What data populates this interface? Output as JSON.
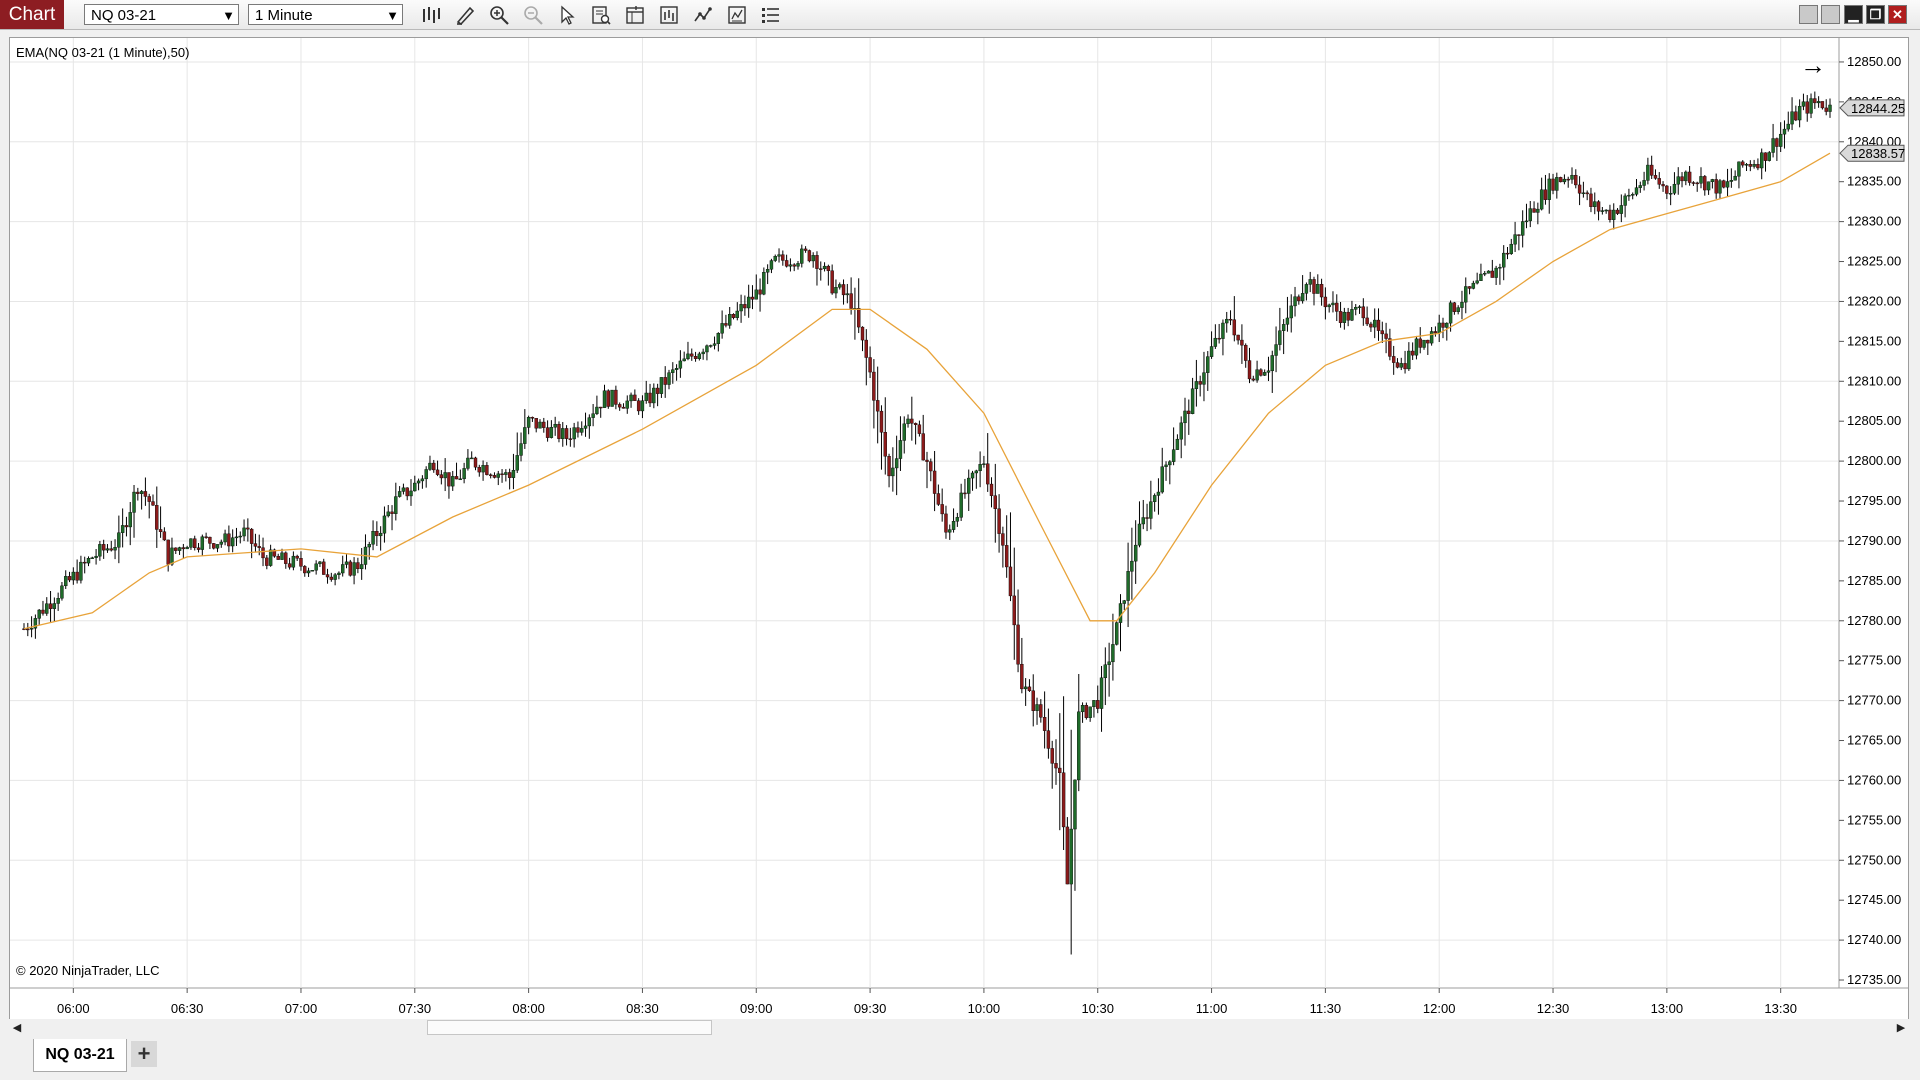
{
  "toolbar": {
    "chart_label": "Chart",
    "instrument": "NQ 03-21",
    "interval": "1 Minute",
    "icons": [
      "bar-type-icon",
      "drawing-tools-icon",
      "zoom-in-icon",
      "zoom-out-icon",
      "pointer-icon",
      "data-box-icon",
      "properties-icon",
      "indicators-icon",
      "strategies-icon",
      "templates-icon"
    ],
    "window_buttons": [
      "minimize-icon",
      "restore-icon",
      "maximize-icon",
      "close-icon"
    ]
  },
  "indicator_label": "EMA(NQ 03-21 (1 Minute),50)",
  "copyright": "© 2020 NinjaTrader, LLC",
  "tabs": [
    {
      "label": "NQ 03-21"
    }
  ],
  "add_tab_label": "+",
  "chart_data": {
    "type": "candlestick",
    "instrument": "NQ 03-21",
    "interval": "1 Minute",
    "x_ticks": [
      "06:00",
      "06:30",
      "07:00",
      "07:30",
      "08:00",
      "08:30",
      "09:00",
      "09:30",
      "10:00",
      "10:30",
      "11:00",
      "11:30",
      "12:00",
      "12:30",
      "13:00",
      "13:30"
    ],
    "y_ticks": [
      "12850.00",
      "12845.00",
      "12840.00",
      "12835.00",
      "12830.00",
      "12825.00",
      "12820.00",
      "12815.00",
      "12810.00",
      "12805.00",
      "12800.00",
      "12795.00",
      "12790.00",
      "12785.00",
      "12780.00",
      "12775.00",
      "12770.00",
      "12765.00",
      "12760.00",
      "12755.00",
      "12750.00",
      "12745.00",
      "12740.00",
      "12735.00"
    ],
    "ylim": [
      12734,
      12853
    ],
    "time_range": [
      "05:47",
      "13:43"
    ],
    "close_path": [
      [
        "05:47",
        12779
      ],
      [
        "05:55",
        12783
      ],
      [
        "06:05",
        12788
      ],
      [
        "06:12",
        12790
      ],
      [
        "06:17",
        12797
      ],
      [
        "06:20",
        12795
      ],
      [
        "06:25",
        12788
      ],
      [
        "06:30",
        12790
      ],
      [
        "06:40",
        12790
      ],
      [
        "06:45",
        12791
      ],
      [
        "06:50",
        12788
      ],
      [
        "07:00",
        12787
      ],
      [
        "07:10",
        12786
      ],
      [
        "07:15",
        12787
      ],
      [
        "07:25",
        12795
      ],
      [
        "07:30",
        12797
      ],
      [
        "07:35",
        12800
      ],
      [
        "07:40",
        12797
      ],
      [
        "07:45",
        12800
      ],
      [
        "07:55",
        12798
      ],
      [
        "08:00",
        12805
      ],
      [
        "08:10",
        12803
      ],
      [
        "08:20",
        12808
      ],
      [
        "08:30",
        12807
      ],
      [
        "08:40",
        12812
      ],
      [
        "08:50",
        12816
      ],
      [
        "09:00",
        12821
      ],
      [
        "09:05",
        12825
      ],
      [
        "09:15",
        12826
      ],
      [
        "09:20",
        12822
      ],
      [
        "09:25",
        12820
      ],
      [
        "09:30",
        12811
      ],
      [
        "09:35",
        12798
      ],
      [
        "09:40",
        12806
      ],
      [
        "09:45",
        12800
      ],
      [
        "09:50",
        12791
      ],
      [
        "09:55",
        12796
      ],
      [
        "10:00",
        12800
      ],
      [
        "10:05",
        12790
      ],
      [
        "10:10",
        12772
      ],
      [
        "10:15",
        12768
      ],
      [
        "10:20",
        12760
      ],
      [
        "10:22",
        12747
      ],
      [
        "10:25",
        12768
      ],
      [
        "10:30",
        12770
      ],
      [
        "10:35",
        12779
      ],
      [
        "10:40",
        12790
      ],
      [
        "10:45",
        12796
      ],
      [
        "10:50",
        12802
      ],
      [
        "10:55",
        12808
      ],
      [
        "11:00",
        12814
      ],
      [
        "11:05",
        12818
      ],
      [
        "11:10",
        12811
      ],
      [
        "11:15",
        12812
      ],
      [
        "11:20",
        12818
      ],
      [
        "11:25",
        12823
      ],
      [
        "11:30",
        12820
      ],
      [
        "11:35",
        12818
      ],
      [
        "11:40",
        12819
      ],
      [
        "11:45",
        12815
      ],
      [
        "11:50",
        12812
      ],
      [
        "11:55",
        12815
      ],
      [
        "12:00",
        12817
      ],
      [
        "12:05",
        12820
      ],
      [
        "12:10",
        12822
      ],
      [
        "12:15",
        12824
      ],
      [
        "12:20",
        12828
      ],
      [
        "12:25",
        12832
      ],
      [
        "12:30",
        12835
      ],
      [
        "12:35",
        12836
      ],
      [
        "12:40",
        12832
      ],
      [
        "12:45",
        12831
      ],
      [
        "12:50",
        12833
      ],
      [
        "12:55",
        12836
      ],
      [
        "13:00",
        12834
      ],
      [
        "13:05",
        12836
      ],
      [
        "13:10",
        12835
      ],
      [
        "13:15",
        12834
      ],
      [
        "13:20",
        12837
      ],
      [
        "13:25",
        12838
      ],
      [
        "13:30",
        12841
      ],
      [
        "13:35",
        12844
      ],
      [
        "13:40",
        12845
      ],
      [
        "13:43",
        12844.25
      ]
    ],
    "last_price": "12844.25",
    "ema": {
      "label": "EMA(NQ 03-21 (1 Minute),50)",
      "period": 50,
      "color": "#e8a33a",
      "last_value": "12838.57",
      "points": [
        [
          "05:47",
          12779
        ],
        [
          "06:05",
          12781
        ],
        [
          "06:20",
          12786
        ],
        [
          "06:30",
          12788
        ],
        [
          "07:00",
          12789
        ],
        [
          "07:20",
          12788
        ],
        [
          "07:40",
          12793
        ],
        [
          "08:00",
          12797
        ],
        [
          "08:30",
          12804
        ],
        [
          "09:00",
          12812
        ],
        [
          "09:20",
          12819
        ],
        [
          "09:30",
          12819
        ],
        [
          "09:45",
          12814
        ],
        [
          "10:00",
          12806
        ],
        [
          "10:15",
          12792
        ],
        [
          "10:28",
          12780
        ],
        [
          "10:35",
          12780
        ],
        [
          "10:45",
          12786
        ],
        [
          "11:00",
          12797
        ],
        [
          "11:15",
          12806
        ],
        [
          "11:30",
          12812
        ],
        [
          "11:45",
          12815
        ],
        [
          "12:00",
          12816
        ],
        [
          "12:15",
          12820
        ],
        [
          "12:30",
          12825
        ],
        [
          "12:45",
          12829
        ],
        [
          "13:00",
          12831
        ],
        [
          "13:15",
          12833
        ],
        [
          "13:30",
          12835
        ],
        [
          "13:43",
          12838.57
        ]
      ]
    },
    "colors": {
      "up": "#1f6b2a",
      "down": "#8b1a1a",
      "wick": "#000000",
      "grid": "#e6e6e6",
      "last_price_tag": "#d9d9d9"
    },
    "grid": true
  }
}
